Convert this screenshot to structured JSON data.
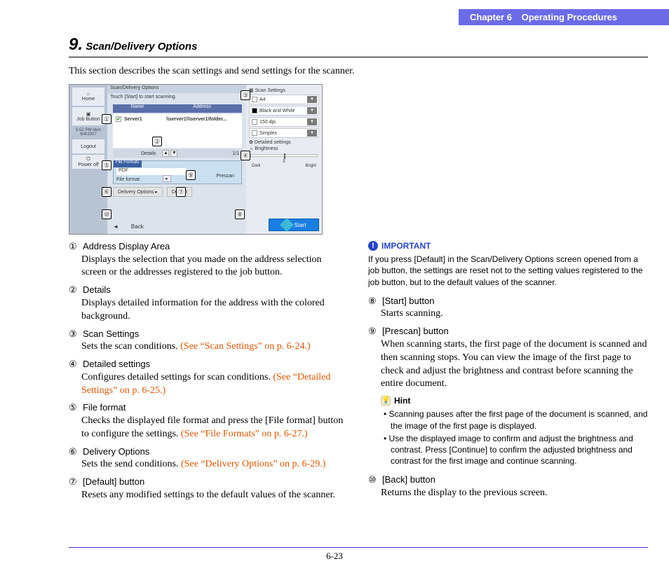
{
  "header": {
    "chapter": "Chapter 6",
    "title": "Operating Procedures"
  },
  "section": {
    "num": "9.",
    "title": "Scan/Delivery Options"
  },
  "intro": "This section describes the scan settings and send settings for the scanner.",
  "screenshot": {
    "left": {
      "home": "Home",
      "job": "Job Button",
      "time": "5:52 PM  Mon 6/4/2007",
      "logout": "Logout",
      "power": "Power off"
    },
    "mid": {
      "title": "Scan/Delivery Options",
      "hint": "Touch [Start] to start scanning.",
      "col_name": "Name",
      "col_addr": "Address",
      "server": "Server1",
      "path": "\\\\server1\\\\\\server1\\folder...",
      "details": "Details",
      "page": "1/1",
      "fileformats_tab": "File Formats",
      "pdf": "PDF",
      "file_format": "File format",
      "prescan": "Prescan",
      "delivery": "Delivery Options",
      "default": "Default",
      "back": "Back"
    },
    "right": {
      "scan_settings": "Scan Settings",
      "a4": "A4",
      "bw": "Black and White",
      "dpi": "150 dpi",
      "simplex": "Simplex",
      "detailed": "Detailed settings",
      "brightness": "Brightness",
      "bright_val": "5",
      "dark": "Dark",
      "bright": "Bright",
      "start": "Start"
    }
  },
  "list": {
    "i1": {
      "n": "①",
      "t": "Address Display Area",
      "d": "Displays the selection that you made on the address selection screen or the addresses registered to the job button."
    },
    "i2": {
      "n": "②",
      "t": "Details",
      "d": "Displays detailed information for the address with the colored background."
    },
    "i3": {
      "n": "③",
      "t": "Scan Settings",
      "d": "Sets the scan conditions. ",
      "link": "(See “Scan Settings” on p. 6-24.)"
    },
    "i4": {
      "n": "④",
      "t": "Detailed settings",
      "d": "Configures detailed settings for scan conditions. ",
      "link": "(See “Detailed Settings” on p. 6-25.)"
    },
    "i5": {
      "n": "⑤",
      "t": "File format",
      "d": "Checks the displayed file format and press the [File format] button to configure the settings. ",
      "link": "(See “File Formats” on p. 6-27.)"
    },
    "i6": {
      "n": "⑥",
      "t": "Delivery Options",
      "d": "Sets the send conditions. ",
      "link": "(See “Delivery Options” on p. 6-29.)"
    },
    "i7": {
      "n": "⑦",
      "t": "[Default] button",
      "d": "Resets any modified settings to the default values of the scanner."
    },
    "i8": {
      "n": "⑧",
      "t": "[Start] button",
      "d": "Starts scanning."
    },
    "i9": {
      "n": "⑨",
      "t": "[Prescan] button",
      "d": "When scanning starts, the first page of the document is scanned and then scanning stops. You can view the image of the first page to check and adjust the brightness and contrast before scanning the entire document."
    },
    "i10": {
      "n": "⑩",
      "t": "[Back] button",
      "d": "Returns the display to the previous screen."
    }
  },
  "important": {
    "label": "IMPORTANT",
    "text": "If you press [Default] in the Scan/Delivery Options screen opened from a job button, the settings are reset not to the setting values registered to the job button, but to the default values of the scanner."
  },
  "hint": {
    "label": "Hint",
    "b1": "Scanning pauses after the first page of the document is scanned, and the image of the first page is displayed.",
    "b2": "Use the displayed image to confirm and adjust the brightness and contrast. Press [Continue] to confirm the adjusted brightness and contrast for the first image and continue scanning."
  },
  "page": "6-23"
}
